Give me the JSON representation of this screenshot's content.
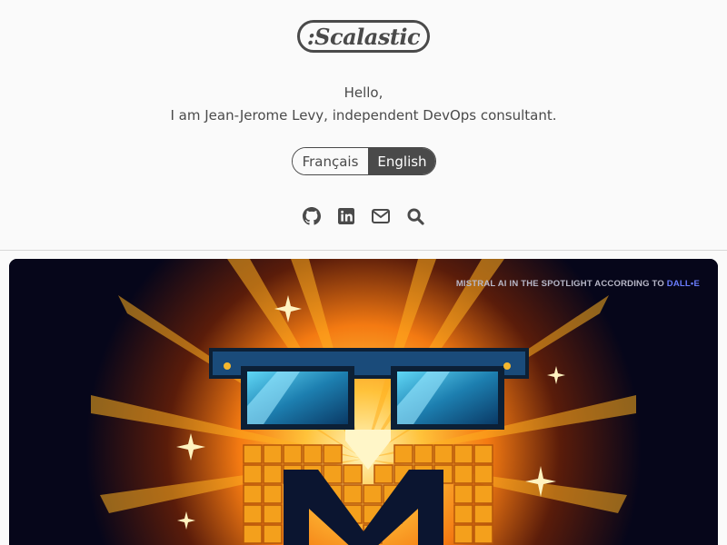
{
  "site": {
    "logo_text": ":Scalastic",
    "greeting": "Hello,",
    "intro": "I am Jean-Jerome Levy, independent DevOps consultant."
  },
  "language_switcher": {
    "options": [
      {
        "label": "Français",
        "active": false
      },
      {
        "label": "English",
        "active": true
      }
    ]
  },
  "social_links": [
    {
      "icon": "github-icon"
    },
    {
      "icon": "linkedin-icon"
    },
    {
      "icon": "mail-icon"
    },
    {
      "icon": "search-icon"
    }
  ],
  "hero": {
    "caption_prefix": "MISTRAL AI IN THE SPOTLIGHT ACCORDING TO ",
    "caption_link": "DALL•E"
  },
  "colors": {
    "text": "#4a4a4a",
    "background": "#fafafa",
    "hero_background": "#05051a",
    "glow": "#ff9a1a",
    "caption_link": "#6a7dff"
  }
}
